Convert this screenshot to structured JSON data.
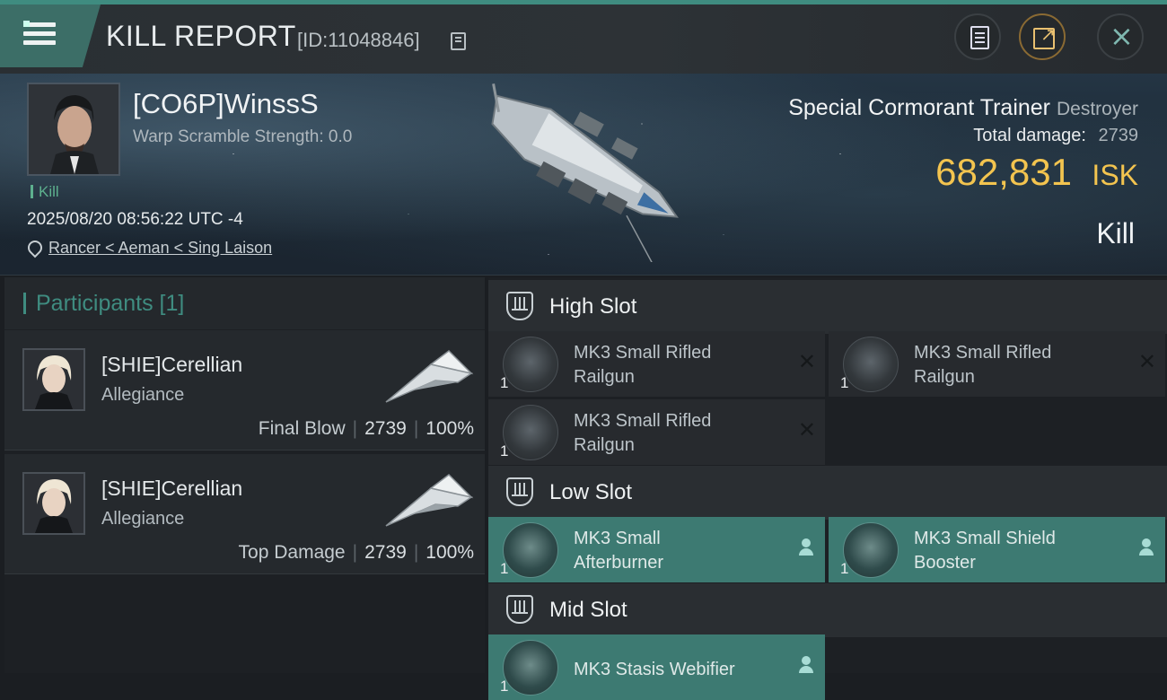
{
  "header": {
    "title": "KILL REPORT",
    "report_id": "[ID:11048846]"
  },
  "victim": {
    "name": "[CO6P]WinssS",
    "warp_scramble": "Warp Scramble Strength: 0.0",
    "kill_tag": "Kill",
    "datetime": "2025/08/20 08:56:22 UTC -4",
    "location": "Rancer < Aeman < Sing Laison",
    "ship_name": "Special Cormorant Trainer",
    "ship_class": "Destroyer",
    "total_damage_label": "Total damage:",
    "total_damage": "2739",
    "isk_value": "682,831",
    "isk_currency": "ISK",
    "result": "Kill"
  },
  "participants": {
    "header": "Participants [1]",
    "items": [
      {
        "name": "[SHIE]Cerellian",
        "alliance": "Allegiance",
        "role": "Final Blow",
        "damage": "2739",
        "percent": "100%"
      },
      {
        "name": "[SHIE]Cerellian",
        "alliance": "Allegiance",
        "role": "Top Damage",
        "damage": "2739",
        "percent": "100%"
      }
    ]
  },
  "fitting": {
    "high": {
      "label": "High Slot",
      "modules": [
        {
          "line1": "MK3 Small Rifled",
          "line2": "Railgun",
          "qty": "1"
        },
        {
          "line1": "MK3 Small Rifled",
          "line2": "Railgun",
          "qty": "1"
        },
        {
          "line1": "MK3 Small Rifled",
          "line2": "Railgun",
          "qty": "1"
        }
      ]
    },
    "low": {
      "label": "Low Slot",
      "modules": [
        {
          "line1": "MK3 Small",
          "line2": "Afterburner",
          "qty": "1"
        },
        {
          "line1": "MK3 Small Shield",
          "line2": "Booster",
          "qty": "1"
        }
      ]
    },
    "mid": {
      "label": "Mid Slot",
      "modules": [
        {
          "line1": "MK3 Stasis Webifier",
          "line2": "",
          "qty": "1"
        }
      ]
    }
  },
  "colors": {
    "accent": "#3f8c80",
    "isk": "#f3c44f",
    "destroyed_module": "#272a2e",
    "dropped_module": "#3d7a72"
  }
}
